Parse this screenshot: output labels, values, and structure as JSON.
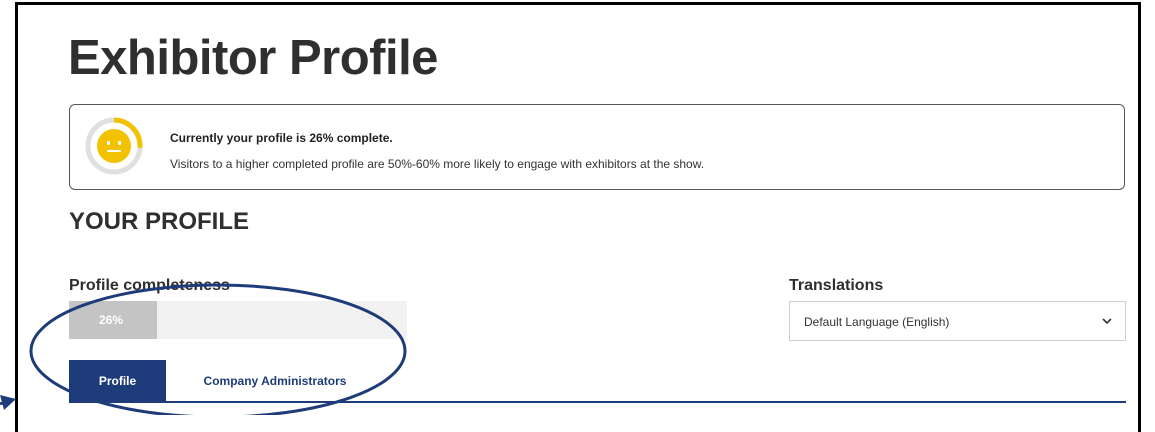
{
  "page": {
    "title": "Exhibitor Profile"
  },
  "notice": {
    "title": "Currently your profile is 26% complete.",
    "body": "Visitors to a higher completed profile are 50%-60% more likely to engage with exhibitors at the show.",
    "icon": "neutral-face-icon",
    "gauge_fraction": 0.26,
    "gauge_color": "#f2c200"
  },
  "profile": {
    "section_title": "YOUR PROFILE",
    "completeness_label": "Profile completeness",
    "completeness_value": "26%",
    "completeness_fraction": 0.26
  },
  "translations": {
    "label": "Translations",
    "selected": "Default Language (English)",
    "icon": "chevron-down-icon"
  },
  "tabs": [
    {
      "label": "Profile",
      "active": true
    },
    {
      "label": "Company Administrators",
      "active": false
    }
  ],
  "colors": {
    "accent": "#1f3c7a",
    "annotation": "#1f3c7a"
  }
}
